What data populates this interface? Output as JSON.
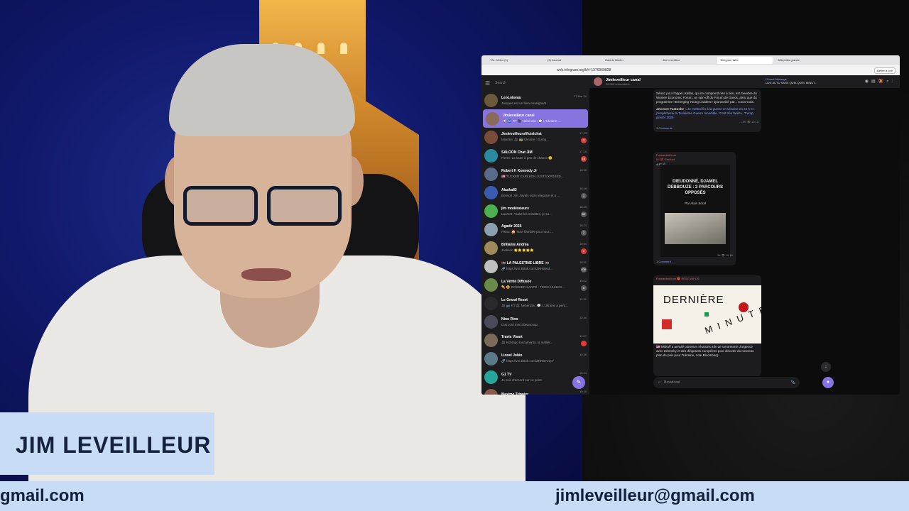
{
  "lower_third": {
    "name": "JIM LEVEILLEUR",
    "email_left": "gmail.com",
    "email_right": "jimleveilleur@gmail.com"
  },
  "browser": {
    "tabs": [
      "TN - Video (1)",
      "(3) Journal",
      "Galerie Nhelm",
      "Jim Leveilleur",
      "Telegram Web",
      "Wikipédia grande"
    ],
    "active_tab_index": 4,
    "url": "web.telegram.org/k/#-1376969828",
    "profile_button": "Mettre à jour"
  },
  "telegram": {
    "search_placeholder": "Search",
    "chats": [
      {
        "name": "LeoLoiseau",
        "preview": "Jacques est un bien enseignant",
        "time": "27 Mar 24",
        "badge": "",
        "badge_red": false,
        "active": false,
        "avatar": "#6a5a3a"
      },
      {
        "name": "Jimleveilleur canal",
        "preview": "📢 Ⓜ️ RT 🎥 Nebenzia : 💬 L'Ukraine ...",
        "time": "17:25",
        "badge": "",
        "badge_red": false,
        "active": true,
        "avatar": "#8a6a5a"
      },
      {
        "name": "Jimleveilleurofficielchat",
        "preview": "Maxime: 🎥 🇺🇦 Ukraine : Europ...",
        "time": "17:23",
        "badge": "3",
        "badge_red": true,
        "active": false,
        "avatar": "#7a4a3a"
      },
      {
        "name": "SALOON Chat JIM",
        "preview": "Pierre: La faute à pas de chance 🙁",
        "time": "17:15",
        "badge": "18",
        "badge_red": true,
        "active": false,
        "avatar": "#2a8aa0"
      },
      {
        "name": "Robert F. Kennedy Jr",
        "preview": "🇺🇸 TUCKER CARLSON JUST EXPOSED...",
        "time": "16:59",
        "badge": "",
        "badge_red": false,
        "active": false,
        "avatar": "#5a6a8a"
      },
      {
        "name": "Alaska83",
        "preview": "Bonsoir Jim J'avais votre telegram et à ...",
        "time": "16:48",
        "badge": "1",
        "badge_red": false,
        "active": false,
        "avatar": "#3a5ab0"
      },
      {
        "name": "jim modérateurs",
        "preview": "Laurent: \"Salut les minettes, je su...",
        "time": "16:45",
        "badge": "60",
        "badge_red": false,
        "active": false,
        "avatar": "#4caf50"
      },
      {
        "name": "Agadir 2025",
        "preview": "Palou: 🍰 Tarte flambée pour tout l...",
        "time": "16:23",
        "badge": "2",
        "badge_red": false,
        "active": false,
        "avatar": "#8aa0b0"
      },
      {
        "name": "Brillante Andréa",
        "preview": "Jackson 🌟🌟🌟🌟🌟",
        "time": "15:54",
        "badge": "1",
        "badge_red": true,
        "active": false,
        "avatar": "#a08a5a"
      },
      {
        "name": "🇵🇸 LA PALESTINE LIBRE 🇵🇸",
        "preview": "🔗 https://vm.tiktok.com/ZNH9kod...",
        "time": "15:51",
        "badge": "636",
        "badge_red": false,
        "active": false,
        "avatar": "#c0c0c0"
      },
      {
        "name": "La Vérité Diffusée",
        "preview": "💊 😄 DOSSIER SANTÉ : TROIS HUILES...",
        "time": "15:02",
        "badge": "5",
        "badge_red": false,
        "active": false,
        "avatar": "#6a8a4a"
      },
      {
        "name": "Le Grand Reset",
        "preview": "🎥 📺 RT 🎥 Nebenzia : 💬 L'Ukraine a perd...",
        "time": "14:41",
        "badge": "",
        "badge_red": false,
        "active": false,
        "avatar": "#2a2a2a"
      },
      {
        "name": "Nino Rino",
        "preview": "D'accord merci beaucoup",
        "time": "12:44",
        "badge": "",
        "badge_red": false,
        "active": false,
        "avatar": "#4a4a5a"
      },
      {
        "name": "Travis Visart",
        "preview": "🎥 Kobrapo toccamento, la mallièr...",
        "time": "12:07",
        "badge": "",
        "badge_red": true,
        "active": false,
        "avatar": "#7a6a5a"
      },
      {
        "name": "Lionel Jobin",
        "preview": "🔗 https://vm.tiktok.com/ZNRS71Q7/",
        "time": "10:36",
        "badge": "",
        "badge_red": false,
        "active": false,
        "avatar": "#5a7a8a"
      },
      {
        "name": "G1 TV",
        "preview": "Je suis d'accord sur ce point.",
        "time": "10:24",
        "badge": "",
        "badge_red": false,
        "active": false,
        "avatar": "#26a69a"
      },
      {
        "name": "Maxime Tripnier",
        "preview": "",
        "time": "10:10",
        "badge": "",
        "badge_red": false,
        "active": false,
        "avatar": "#8a5a4a"
      }
    ],
    "channel": {
      "title": "Jimleveilleur canal",
      "subscribers": "28 960 subscribers",
      "pinned_label": "Pinned Message",
      "pinned_text": "LIVE ACTU SANS QUELQUES MINUT..."
    },
    "post1": {
      "text": "Sénat, pour l'appel, Kallas, qui ne comprend rien à rien, est membre du Women Economic Forum, un spin-off du Forum de Davos, ainsi que du programme «Emerging Young Leaders» sponsorisé par... Coca-Cola.",
      "archive_label": "ARCHIVE",
      "archive_author": "Fastoche",
      "archive_text": "« Je mettrai fin à la guerre en Ukraine en 24 h et j'empêcherai la Troisième Guerre mondiale. C'est très facile», Trump, janvier 2025",
      "meta": "1.5K 👁 13:13",
      "comments": "3 Comments"
    },
    "video": {
      "forwarded": "Forwarded from",
      "source": "ILI 💯 Gm/foot",
      "duration": "4:47 🔊",
      "title": "DIEUDONNÉ, DJAMEL DEBBOUZE : 2 PARCOURS OPPOSÉS",
      "byline": "Par Alain Soral",
      "meta": "3K 👁 16:16",
      "comments": "1 Comment"
    },
    "news": {
      "forwarded": "Forwarded from",
      "source": "🔴 RÉSIT INFOS",
      "word_top": "DERNIÈRE",
      "word_bottom": "MINUTE",
      "text": "🇺🇸 Witkoff a annulé plusieurs réunions afin de s'entretenir d'urgence avec Zelensky et des dirigeants européens pour discuter du nouveau plan de paix pour l'Ukraine, note Bloomberg."
    },
    "composer_placeholder": "Broadcast"
  },
  "colors": {
    "accent": "#8774e1",
    "lower_third": "#c9dcf5",
    "text_dark": "#12223e"
  }
}
